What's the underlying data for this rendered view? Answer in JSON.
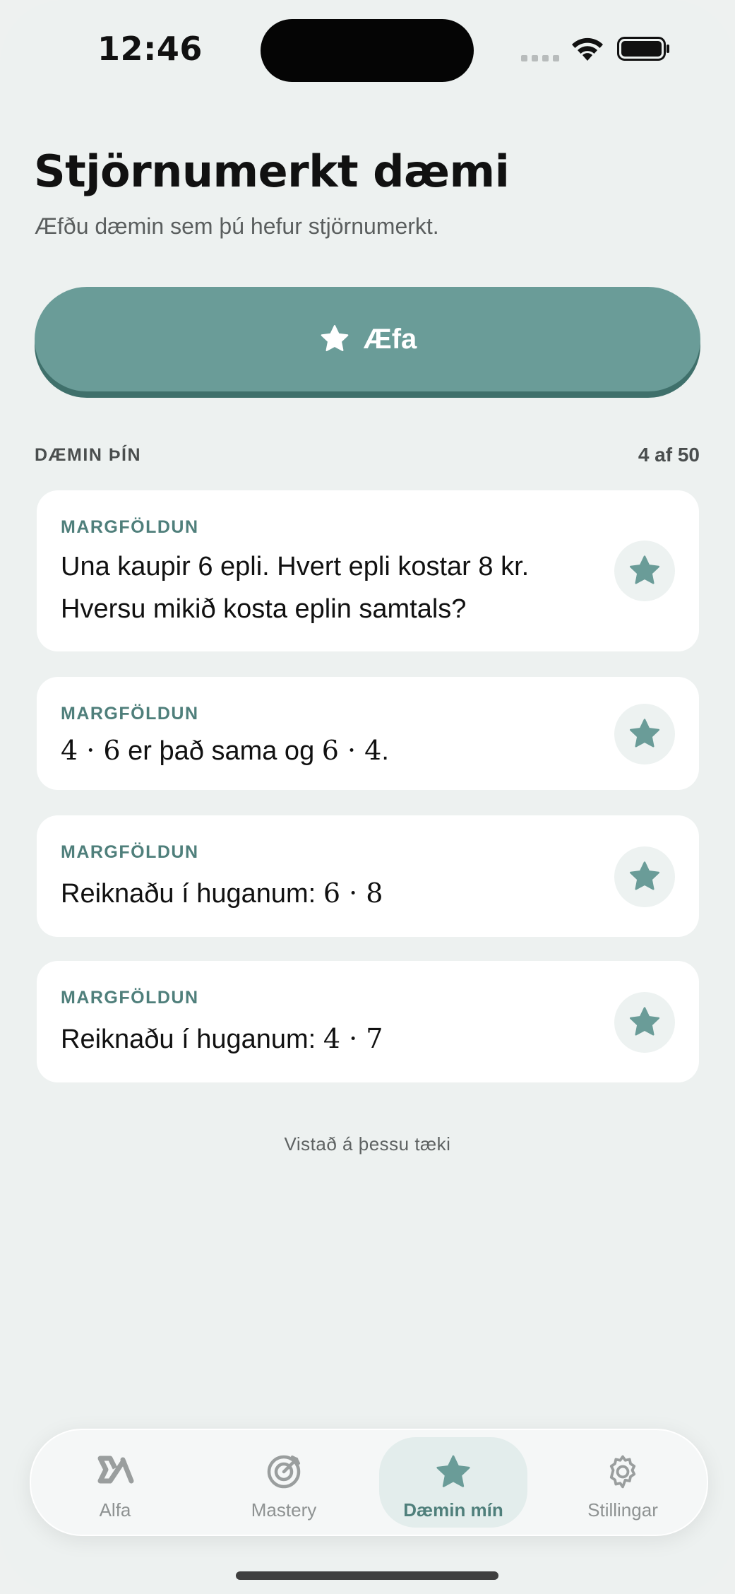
{
  "status_bar": {
    "time": "12:46"
  },
  "header": {
    "title": "Stjörnumerkt dæmi",
    "subtitle": "Æfðu dæmin sem þú hefur stjörnumerkt."
  },
  "practice_button": {
    "label": "Æfa",
    "icon": "star-icon"
  },
  "section": {
    "label": "DÆMIN ÞÍN",
    "count": "4 af 50"
  },
  "cards": [
    {
      "tag": "MARGFÖLDUN",
      "line1": "Una kaupir 6 epli. Hvert epli kostar 8 kr.",
      "line2": "Hversu mikið kosta eplin samtals?"
    },
    {
      "tag": "MARGFÖLDUN",
      "math_a": "4 · 6",
      "text_mid": " er það sama og ",
      "math_b": "6 · 4",
      "text_end": "."
    },
    {
      "tag": "MARGFÖLDUN",
      "prefix": "Reiknaðu í huganum: ",
      "math": "6 · 8"
    },
    {
      "tag": "MARGFÖLDUN",
      "prefix": "Reiknaðu í huganum: ",
      "math": "4 · 7"
    }
  ],
  "footer_note": "Vistað á þessu tæki",
  "tabs": [
    {
      "label": "Alfa",
      "icon": "alfa-icon"
    },
    {
      "label": "Mastery",
      "icon": "target-icon"
    },
    {
      "label": "Dæmin mín",
      "icon": "star-icon",
      "active": true
    },
    {
      "label": "Stillingar",
      "icon": "gear-icon"
    }
  ],
  "colors": {
    "accent": "#6a9c98",
    "accent_dark": "#3f706b",
    "tag": "#4f7f7b",
    "background": "#edf1f0"
  }
}
